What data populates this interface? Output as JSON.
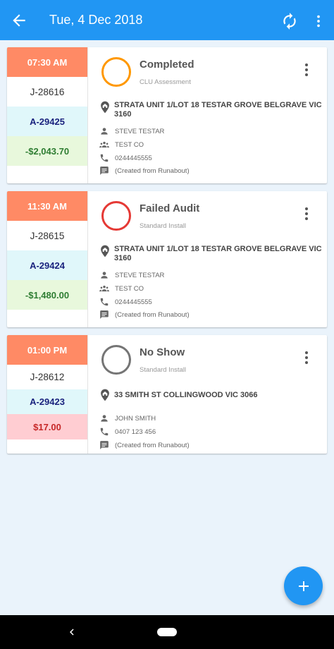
{
  "header": {
    "title": "Tue, 4 Dec 2018",
    "back_icon": "arrow-left-icon",
    "refresh_icon": "refresh-icon",
    "more_icon": "more-vert-icon"
  },
  "colors": {
    "primary": "#2196f3",
    "time_bg": "#ff8a65",
    "invoice_bg": "#e0f7fa",
    "credit_bg": "#e8f8dc",
    "due_bg": "#ffcdd2",
    "status_completed": "#ff9800",
    "status_failed": "#e53935",
    "status_noshow": "#757575"
  },
  "jobs": [
    {
      "time": "07:30 AM",
      "job_no": "J-28616",
      "invoice_no": "A-29425",
      "amount": "-$2,043.70",
      "amount_type": "credit",
      "status": "Completed",
      "status_color": "#ff9800",
      "job_type": "CLU Assessment",
      "address": "STRATA UNIT 1/LOT 18 TESTAR GROVE  BELGRAVE VIC 3160",
      "contact": "STEVE TESTAR",
      "company": "TEST CO",
      "phone": "0244445555",
      "note": "(Created from Runabout)"
    },
    {
      "time": "11:30 AM",
      "job_no": "J-28615",
      "invoice_no": "A-29424",
      "amount": "-$1,480.00",
      "amount_type": "credit",
      "status": "Failed Audit",
      "status_color": "#e53935",
      "job_type": "Standard Install",
      "address": "STRATA UNIT 1/LOT 18 TESTAR GROVE  BELGRAVE VIC 3160",
      "contact": "STEVE TESTAR",
      "company": "TEST CO",
      "phone": "0244445555",
      "note": "(Created from Runabout)"
    },
    {
      "time": "01:00 PM",
      "job_no": "J-28612",
      "invoice_no": "A-29423",
      "amount": "$17.00",
      "amount_type": "due",
      "status": "No Show",
      "status_color": "#757575",
      "job_type": "Standard Install",
      "address": "33 SMITH ST  COLLINGWOOD VIC 3066",
      "contact": "JOHN SMITH",
      "phone": "0407 123 456",
      "note": "(Created from Runabout)"
    }
  ],
  "fab": {
    "icon": "plus-icon"
  }
}
